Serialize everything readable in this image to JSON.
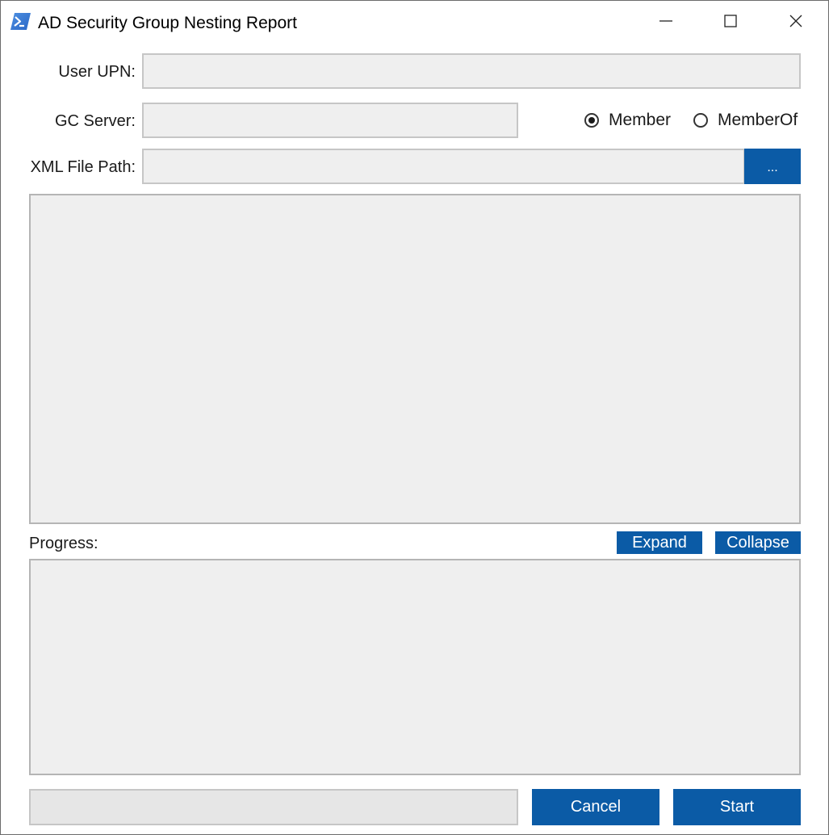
{
  "window": {
    "title": "AD Security Group Nesting Report"
  },
  "form": {
    "user_upn_label": "User UPN:",
    "user_upn_value": "",
    "gc_server_label": "GC Server:",
    "gc_server_value": "",
    "xml_path_label": "XML File Path:",
    "xml_path_value": "",
    "browse_label": "...",
    "radio_member_label": "Member",
    "radio_memberof_label": "MemberOf",
    "selected_radio": "Member"
  },
  "progress": {
    "label": "Progress:",
    "expand_label": "Expand",
    "collapse_label": "Collapse",
    "progress_fraction": 0
  },
  "footer": {
    "cancel_label": "Cancel",
    "start_label": "Start"
  },
  "icons": {
    "app": "powershell-icon",
    "minimize": "minimize-icon",
    "maximize": "maximize-icon",
    "close": "close-icon"
  },
  "colors": {
    "accent": "#0b5ba6",
    "field_bg": "#efefef",
    "field_border": "#c6c6c6"
  }
}
